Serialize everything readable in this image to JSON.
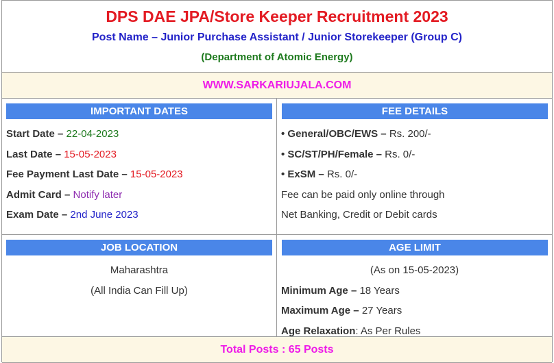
{
  "header": {
    "title": "DPS DAE JPA/Store Keeper Recruitment 2023",
    "post_name": "Post Name – Junior Purchase Assistant / Junior Storekeeper (Group C)",
    "department": "(Department of Atomic Energy)"
  },
  "website": "WWW.SARKARIUJALA.COM",
  "important_dates": {
    "heading": "IMPORTANT DATES",
    "items": [
      {
        "label": "Start Date –",
        "value": "22-04-2023",
        "color": "#1e7a1e"
      },
      {
        "label": "Last Date –",
        "value": "15-05-2023",
        "color": "#e31b23"
      },
      {
        "label": "Fee Payment Last Date –",
        "value": "15-05-2023",
        "color": "#e31b23"
      },
      {
        "label": "Admit Card –",
        "value": "Notify later",
        "color": "#8e2cb0"
      },
      {
        "label": "Exam Date –",
        "value": "2nd June 2023",
        "color": "#2323c8"
      }
    ]
  },
  "fee_details": {
    "heading": "FEE DETAILS",
    "items": [
      {
        "label": "• General/OBC/EWS –",
        "value": "Rs. 200/-"
      },
      {
        "label": "• SC/ST/PH/Female –",
        "value": "Rs. 0/-"
      },
      {
        "label": "• ExSM –",
        "value": "Rs. 0/-"
      }
    ],
    "note_line1": "Fee can be paid only online through",
    "note_line2": "Net Banking, Credit or Debit cards"
  },
  "job_location": {
    "heading": "JOB LOCATION",
    "state": "Maharashtra",
    "note": "(All India Can Fill Up)"
  },
  "age_limit": {
    "heading": "AGE LIMIT",
    "as_on": "(As on 15-05-2023)",
    "min_label": "Minimum Age –",
    "min_value": "18 Years",
    "max_label": "Maximum Age –",
    "max_value": "27 Years",
    "relax_label": "Age Relaxation",
    "relax_value": ": As Per Rules"
  },
  "total_posts": "Total Posts : 65 Posts",
  "colors": {
    "title_red": "#e31b23",
    "post_blue": "#2323c8",
    "dept_green": "#1e7a1e",
    "magenta": "#ee1ce8",
    "bar_blue": "#4a86e8",
    "band_cream": "#fdf7e4"
  }
}
